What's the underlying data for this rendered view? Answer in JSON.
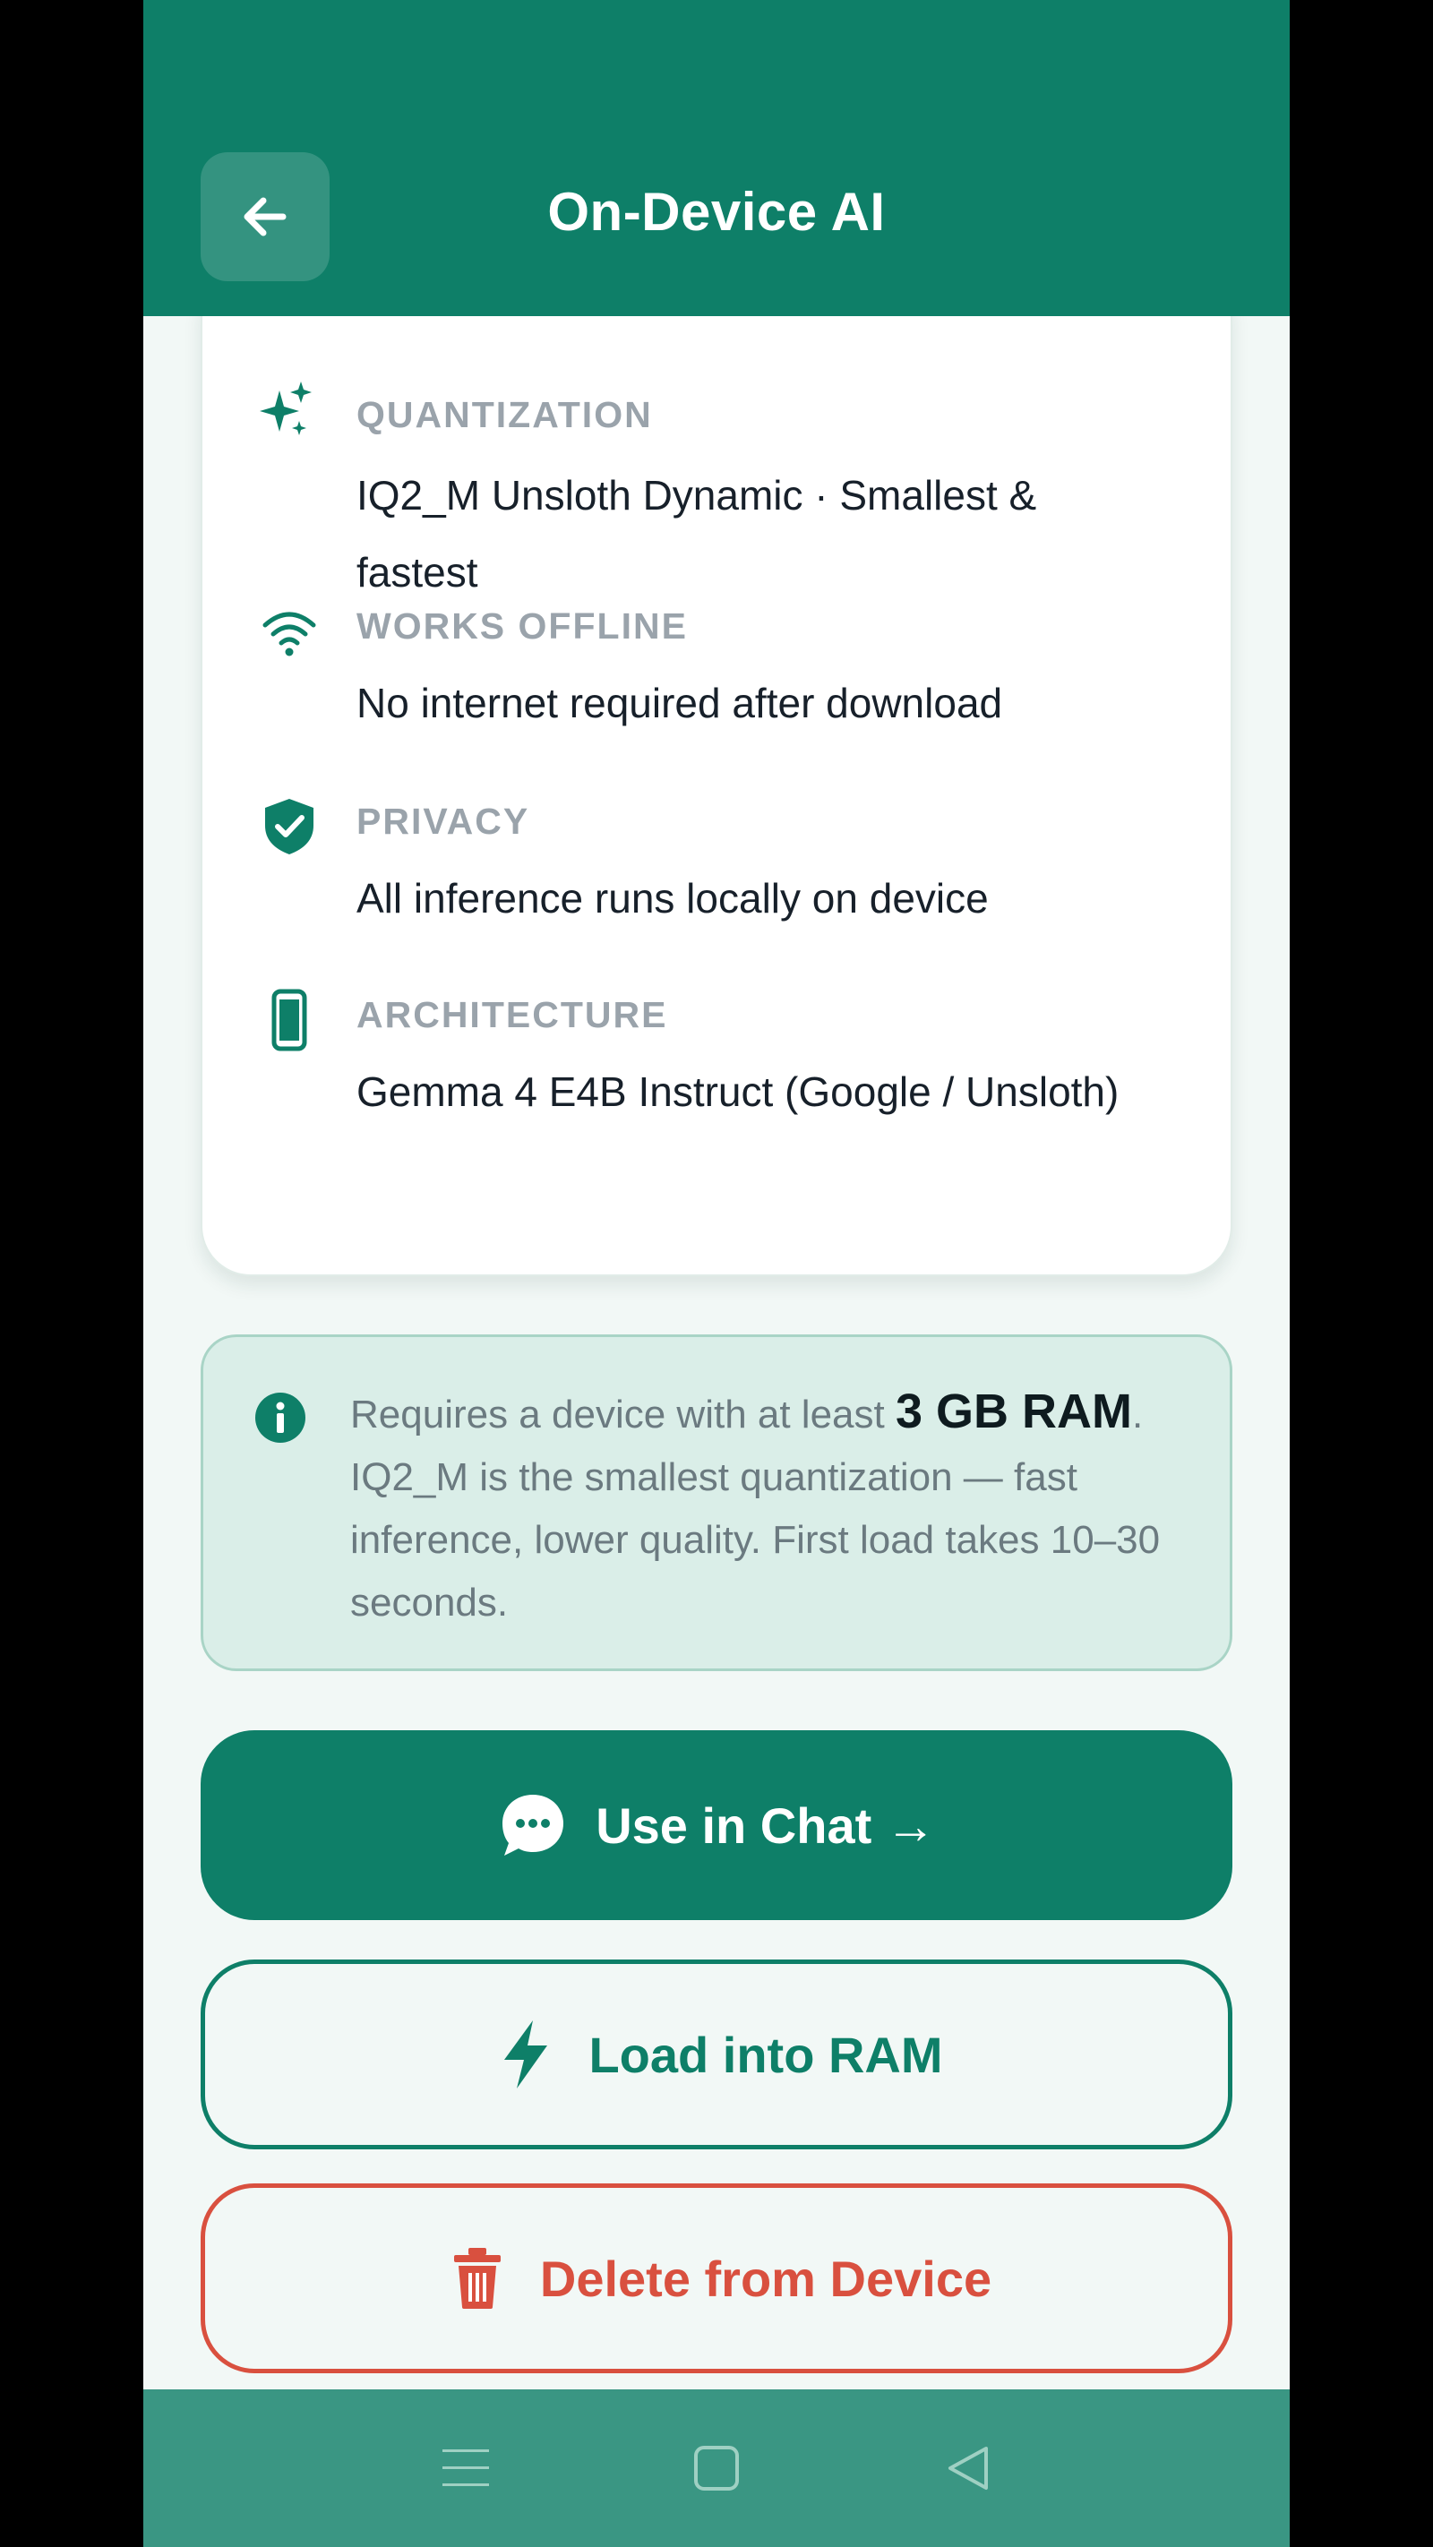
{
  "header": {
    "title": "On-Device AI",
    "back_icon": "arrow-left-icon"
  },
  "details": [
    {
      "icon": "sparkles-icon",
      "label": "QUANTIZATION",
      "value": "IQ2_M Unsloth Dynamic · Smallest & fastest"
    },
    {
      "icon": "wifi-icon",
      "label": "WORKS OFFLINE",
      "value": "No internet required after download"
    },
    {
      "icon": "shield-check-icon",
      "label": "PRIVACY",
      "value": "All inference runs locally on device"
    },
    {
      "icon": "phone-icon",
      "label": "ARCHITECTURE",
      "value": "Gemma 4 E4B Instruct (Google / Unsloth)"
    }
  ],
  "info": {
    "icon": "info-icon",
    "text_before": "Requires a device with at least ",
    "highlight": "3 GB RAM",
    "text_after": ". IQ2_M is the smallest quantization — fast inference, lower quality. First load takes 10–30 seconds."
  },
  "buttons": {
    "chat": {
      "label": "Use in Chat →",
      "icon": "chat-bubble-icon"
    },
    "ram": {
      "label": "Load into RAM",
      "icon": "lightning-icon"
    },
    "delete": {
      "label": "Delete from Device",
      "icon": "trash-icon"
    }
  },
  "colors": {
    "primary": "#0e7f68",
    "danger": "#d9503f",
    "background": "#f2f8f6",
    "info_bg": "#daeee8"
  },
  "navbar": {
    "icons": [
      "menu-icon",
      "home-square-icon",
      "back-triangle-icon"
    ]
  }
}
